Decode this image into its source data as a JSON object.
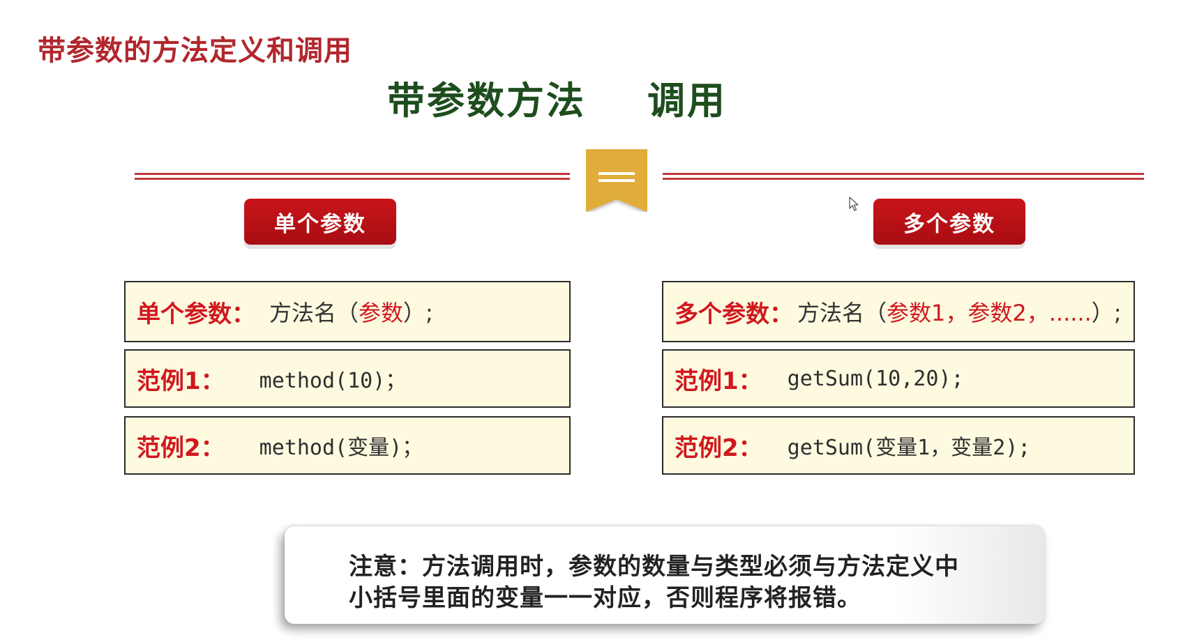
{
  "header": {
    "page_heading": "带参数的方法定义和调用",
    "title_left": "带参数方法",
    "title_right": "调用"
  },
  "ribbon_icon": "bookmark-ribbon-icon",
  "left_panel": {
    "pill_label": "单个参数",
    "format_label": "单个参数：",
    "format_text": "方法名（",
    "format_param": "参数",
    "format_end": "）;",
    "example1_label": "范例1：",
    "example1_code": "method(10)；",
    "example2_label": "范例2：",
    "example2_code": "method(变量)；"
  },
  "right_panel": {
    "pill_label": "多个参数",
    "format_label": "多个参数：",
    "format_text": "方法名（",
    "format_param": "参数1，参数2，......",
    "format_end": "）;",
    "example1_label": "范例1：",
    "example1_code": "getSum(10,20);",
    "example2_label": "范例2：",
    "example2_code": "getSum(变量1，变量2);"
  },
  "note": {
    "line1": "注意：方法调用时，参数的数量与类型必须与方法定义中",
    "line2": "小括号里面的变量一一对应，否则程序将报错。"
  },
  "colors": {
    "heading_red": "#b0272d",
    "title_green": "#1e4d1e",
    "pill_red": "#c8151b",
    "box_fill": "#fdfae0",
    "ribbon_gold": "#e0ad3a"
  }
}
